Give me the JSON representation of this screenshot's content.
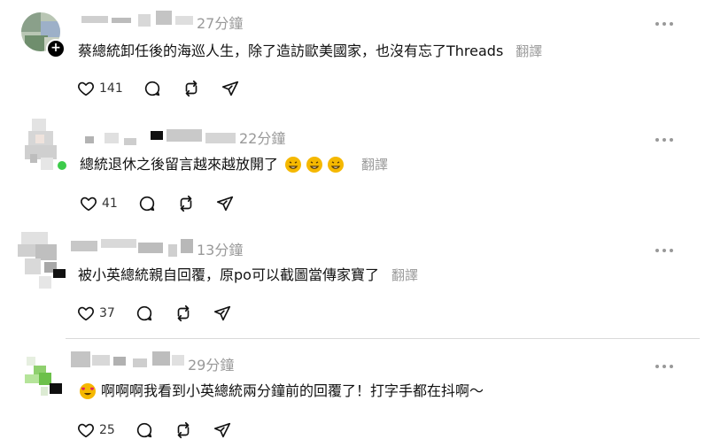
{
  "comments": [
    {
      "time": "27分鐘",
      "text": "蔡總統卸任後的海巡人生，除了造訪歐美國家，也沒有忘了Threads",
      "translate": "翻譯",
      "likes": "141",
      "emojis": []
    },
    {
      "time": "22分鐘",
      "text": "總統退休之後留言越來越放開了",
      "translate": "翻譯",
      "likes": "41",
      "emojis": [
        "rofl-emoji",
        "rofl-emoji",
        "rofl-emoji"
      ]
    },
    {
      "time": "13分鐘",
      "text": "被小英總統親自回覆，原po可以截圖當傳家寶了",
      "translate": "翻譯",
      "likes": "37",
      "emojis": []
    },
    {
      "time": "29分鐘",
      "text": "啊啊啊我看到小英總統兩分鐘前的回覆了！打字手都在抖啊～",
      "translate": "",
      "likes": "25",
      "emojis": [
        "heart-eyes-emoji"
      ]
    }
  ],
  "icons": {
    "like": "heart-icon",
    "reply": "comment-icon",
    "repost": "repost-icon",
    "share": "send-icon",
    "more": "more-icon"
  },
  "colors": {
    "muted": "#999999",
    "online": "#3ccb4a",
    "emoji": "#f5b800"
  }
}
